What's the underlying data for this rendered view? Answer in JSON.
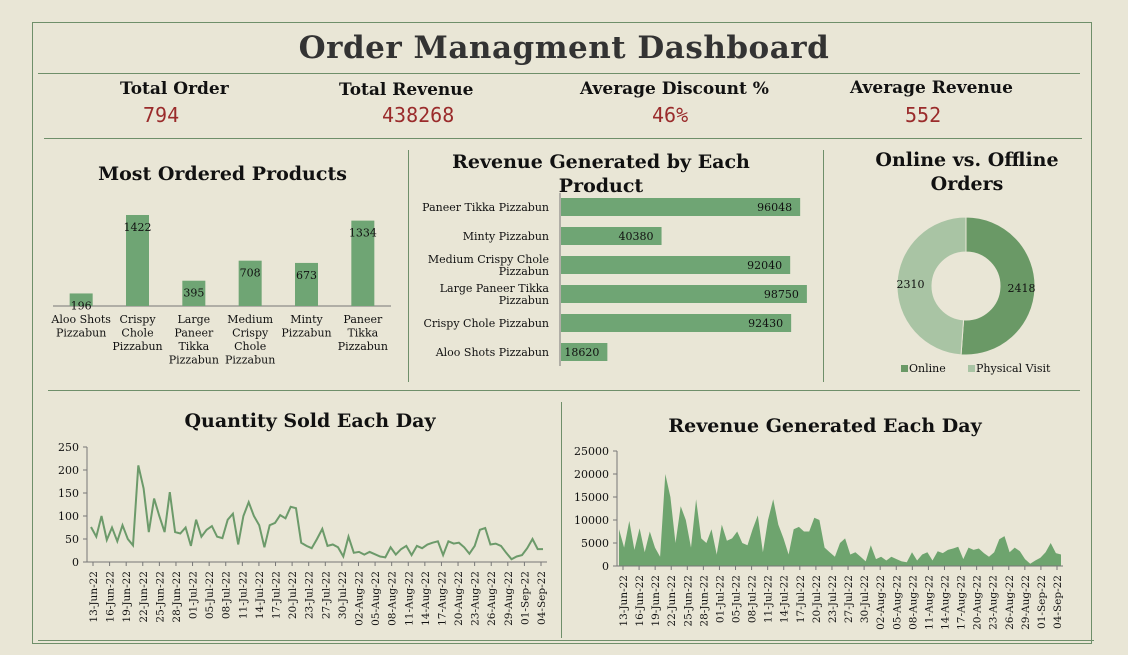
{
  "title": "Order Managment Dashboard",
  "kpis": [
    {
      "label": "Total  Order",
      "value": "794"
    },
    {
      "label": "Total  Revenue",
      "value": "438268"
    },
    {
      "label": "Average Discount  %",
      "value": "46%"
    },
    {
      "label": "Average Revenue",
      "value": "552"
    }
  ],
  "colors": {
    "bar": "#6fa574",
    "line": "#6c9a6a",
    "area": "#6ea46e",
    "online": "#6a9966",
    "physical": "#a9c4a4",
    "kpi_value": "#9a2b2b"
  },
  "chart_data": [
    {
      "type": "bar",
      "title": "Most Ordered Products",
      "categories": [
        "Aloo Shots Pizzabun",
        "Crispy Chole Pizzabun",
        "Large Paneer Tikka Pizzabun",
        "Medium Crispy Chole Pizzabun",
        "Minty Pizzabun",
        "Paneer Tikka Pizzabun"
      ],
      "category_lines": [
        [
          "Aloo Shots",
          "Pizzabun"
        ],
        [
          "Crispy",
          "Chole",
          "Pizzabun"
        ],
        [
          "Large",
          "Paneer",
          "Tikka",
          "Pizzabun"
        ],
        [
          "Medium",
          "Crispy",
          "Chole",
          "Pizzabun"
        ],
        [
          "Minty",
          "Pizzabun"
        ],
        [
          "Paneer",
          "Tikka",
          "Pizzabun"
        ]
      ],
      "values": [
        196,
        1422,
        395,
        708,
        673,
        1334
      ],
      "labels": [
        "196",
        "1422",
        "395",
        "708",
        "673",
        "1334"
      ],
      "ylim": [
        0,
        1500
      ]
    },
    {
      "type": "bar",
      "orientation": "horizontal",
      "title": "Revenue Generated by Each Product",
      "title_lines": [
        "Revenue Generated by Each",
        "Product"
      ],
      "categories": [
        "Paneer Tikka Pizzabun",
        "Minty Pizzabun",
        "Medium Crispy Chole Pizzabun",
        "Large Paneer Tikka Pizzabun",
        "Crispy Chole  Pizzabun",
        "Aloo Shots  Pizzabun"
      ],
      "category_lines": [
        [
          "Paneer Tikka Pizzabun"
        ],
        [
          "Minty Pizzabun"
        ],
        [
          "Medium Crispy Chole",
          "Pizzabun"
        ],
        [
          "Large Paneer Tikka",
          "Pizzabun"
        ],
        [
          "Crispy Chole  Pizzabun"
        ],
        [
          "Aloo Shots  Pizzabun"
        ]
      ],
      "values": [
        96048,
        40380,
        92040,
        98750,
        92430,
        18620
      ],
      "labels": [
        "96048",
        "40380",
        "92040",
        "98750",
        "92430",
        "18620"
      ],
      "xlim": [
        0,
        100000
      ]
    },
    {
      "type": "pie",
      "donut": true,
      "title": "Online vs. Offline Orders",
      "title_lines": [
        "Online vs. Offline",
        "Orders"
      ],
      "slices": [
        {
          "name": "Online",
          "value": 2418,
          "label": "2418"
        },
        {
          "name": "Physical Visit",
          "value": 2310,
          "label": "2310"
        }
      ],
      "legend": "bottom"
    },
    {
      "type": "line",
      "title": "Quantity Sold Each Day",
      "ylim": [
        0,
        250
      ],
      "yticks": [
        "0",
        "50",
        "100",
        "150",
        "200",
        "250"
      ],
      "xtick_labels": [
        "13-Jun-22",
        "16-Jun-22",
        "19-Jun-22",
        "22-Jun-22",
        "25-Jun-22",
        "28-Jun-22",
        "01-Jul-22",
        "05-Jul-22",
        "08-Jul-22",
        "11-Jul-22",
        "14-Jul-22",
        "17-Jul-22",
        "20-Jul-22",
        "23-Jul-22",
        "27-Jul-22",
        "30-Jul-22",
        "02-Aug-22",
        "05-Aug-22",
        "08-Aug-22",
        "11-Aug-22",
        "14-Aug-22",
        "17-Aug-22",
        "20-Aug-22",
        "23-Aug-22",
        "26-Aug-22",
        "29-Aug-22",
        "01-Sep-22",
        "04-Sep-22"
      ],
      "values": [
        76,
        55,
        100,
        48,
        75,
        45,
        80,
        50,
        36,
        210,
        160,
        65,
        138,
        100,
        65,
        152,
        65,
        62,
        75,
        35,
        92,
        55,
        70,
        78,
        55,
        52,
        92,
        105,
        38,
        100,
        130,
        100,
        80,
        32,
        80,
        85,
        102,
        95,
        120,
        117,
        42,
        35,
        30,
        50,
        72,
        35,
        38,
        32,
        12,
        55,
        20,
        22,
        16,
        22,
        17,
        12,
        10,
        32,
        16,
        28,
        35,
        15,
        35,
        30,
        38,
        42,
        45,
        15,
        45,
        40,
        42,
        32,
        18,
        35,
        70,
        74,
        38,
        40,
        35,
        20,
        6,
        12,
        15,
        30,
        50,
        28,
        28
      ]
    },
    {
      "type": "area",
      "title": "Revenue Generated Each Day",
      "ylim": [
        0,
        25000
      ],
      "yticks": [
        "0",
        "5000",
        "10000",
        "15000",
        "20000",
        "25000"
      ],
      "xtick_labels": [
        "13-Jun-22",
        "16-Jun-22",
        "19-Jun-22",
        "22-Jun-22",
        "25-Jun-22",
        "28-Jun-22",
        "01-Jul-22",
        "05-Jul-22",
        "08-Jul-22",
        "11-Jul-22",
        "14-Jul-22",
        "17-Jul-22",
        "20-Jul-22",
        "23-Jul-22",
        "27-Jul-22",
        "30-Jul-22",
        "02-Aug-22",
        "05-Aug-22",
        "08-Aug-22",
        "11-Aug-22",
        "14-Aug-22",
        "17-Aug-22",
        "20-Aug-22",
        "23-Aug-22",
        "26-Aug-22",
        "29-Aug-22",
        "01-Sep-22",
        "04-Sep-22"
      ],
      "values": [
        8000,
        4000,
        9800,
        3500,
        8200,
        3000,
        7500,
        4000,
        2000,
        20000,
        15000,
        5000,
        13000,
        10000,
        4000,
        14500,
        6000,
        5000,
        8000,
        2500,
        9000,
        5500,
        6000,
        7500,
        5000,
        4500,
        8000,
        11000,
        3000,
        10000,
        14500,
        9000,
        6000,
        2500,
        8000,
        8500,
        7500,
        7500,
        10500,
        10000,
        4000,
        3000,
        2000,
        5000,
        6000,
        2500,
        3000,
        2000,
        1000,
        4500,
        1500,
        2000,
        1200,
        2000,
        1500,
        1000,
        800,
        3000,
        1200,
        2500,
        3000,
        1200,
        3200,
        2800,
        3500,
        3800,
        4200,
        1500,
        4000,
        3500,
        3800,
        2800,
        2000,
        3000,
        5800,
        6500,
        3000,
        4000,
        3200,
        1500,
        500,
        1200,
        1800,
        3000,
        5000,
        2800,
        2500
      ]
    }
  ]
}
